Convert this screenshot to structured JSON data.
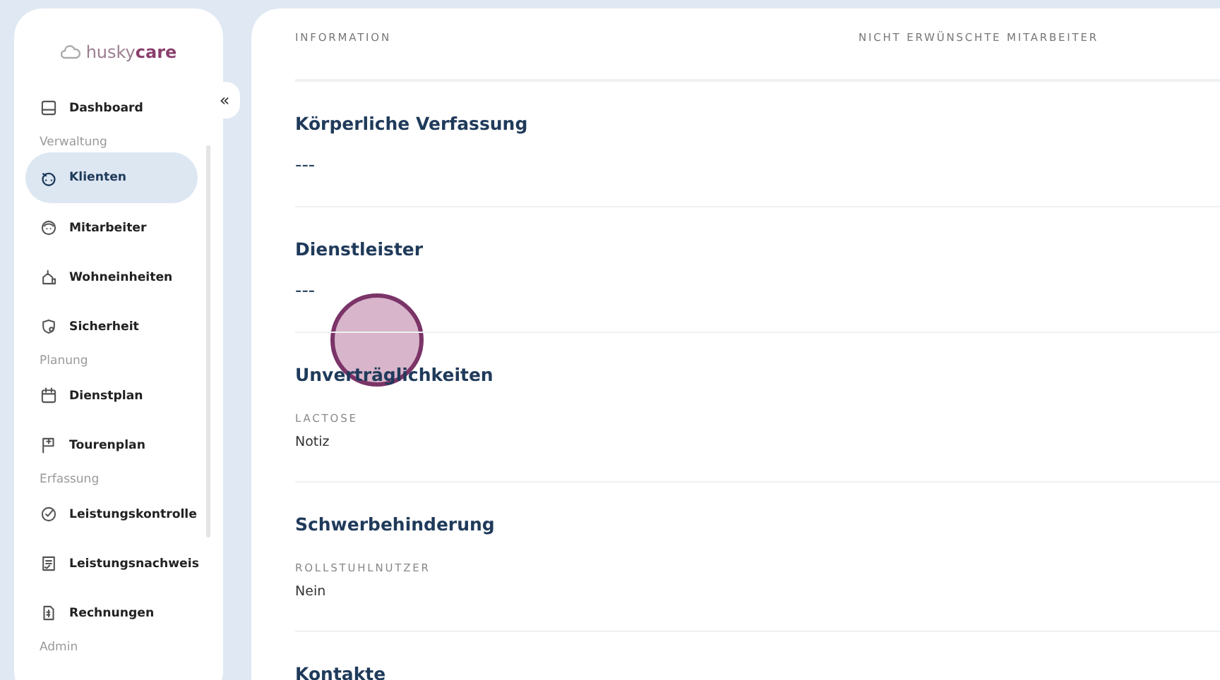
{
  "logo": "husky**care**",
  "sidebar": {
    "groups": [
      {
        "items": [
          {
            "label": "Dashboard",
            "selected": false
          }
        ]
      },
      {
        "label": "Verwaltung",
        "items": [
          {
            "label": "Klienten",
            "selected": true
          },
          {
            "label": "Mitarbeiter",
            "selected": false
          },
          {
            "label": "Wohneinheiten",
            "selected": false
          },
          {
            "label": "Sicherheit",
            "selected": false
          }
        ]
      },
      {
        "label": "Planung",
        "items": [
          {
            "label": "Dienstplan",
            "selected": false
          },
          {
            "label": "Tourenplan",
            "selected": false
          }
        ]
      },
      {
        "label": "Erfassung",
        "items": [
          {
            "label": "Leistungskontrolle",
            "selected": false
          },
          {
            "label": "Leistungsnachweis",
            "selected": false
          },
          {
            "label": "Rechnungen",
            "selected": false
          }
        ]
      },
      {
        "label": "Admin"
      }
    ]
  },
  "collapse_button": "«",
  "tabs": [
    "INFORMATION",
    "NICHT ERWÜNSCHTE MITARBEITER"
  ],
  "sections": [
    {
      "title": "Körperliche Verfassung",
      "kind": "empty",
      "value": "---"
    },
    {
      "title": "Dienstleister",
      "kind": "empty",
      "value": "---"
    },
    {
      "title": "Unverträglichkeiten",
      "kind": "field",
      "label": "LACTOSE",
      "value": "Notiz"
    },
    {
      "title": "Schwerbehinderung",
      "kind": "field",
      "label": "ROLLSTUHLNUTZER",
      "value": "Nein"
    },
    {
      "title": "Kontakte",
      "kind": "heading"
    }
  ]
}
